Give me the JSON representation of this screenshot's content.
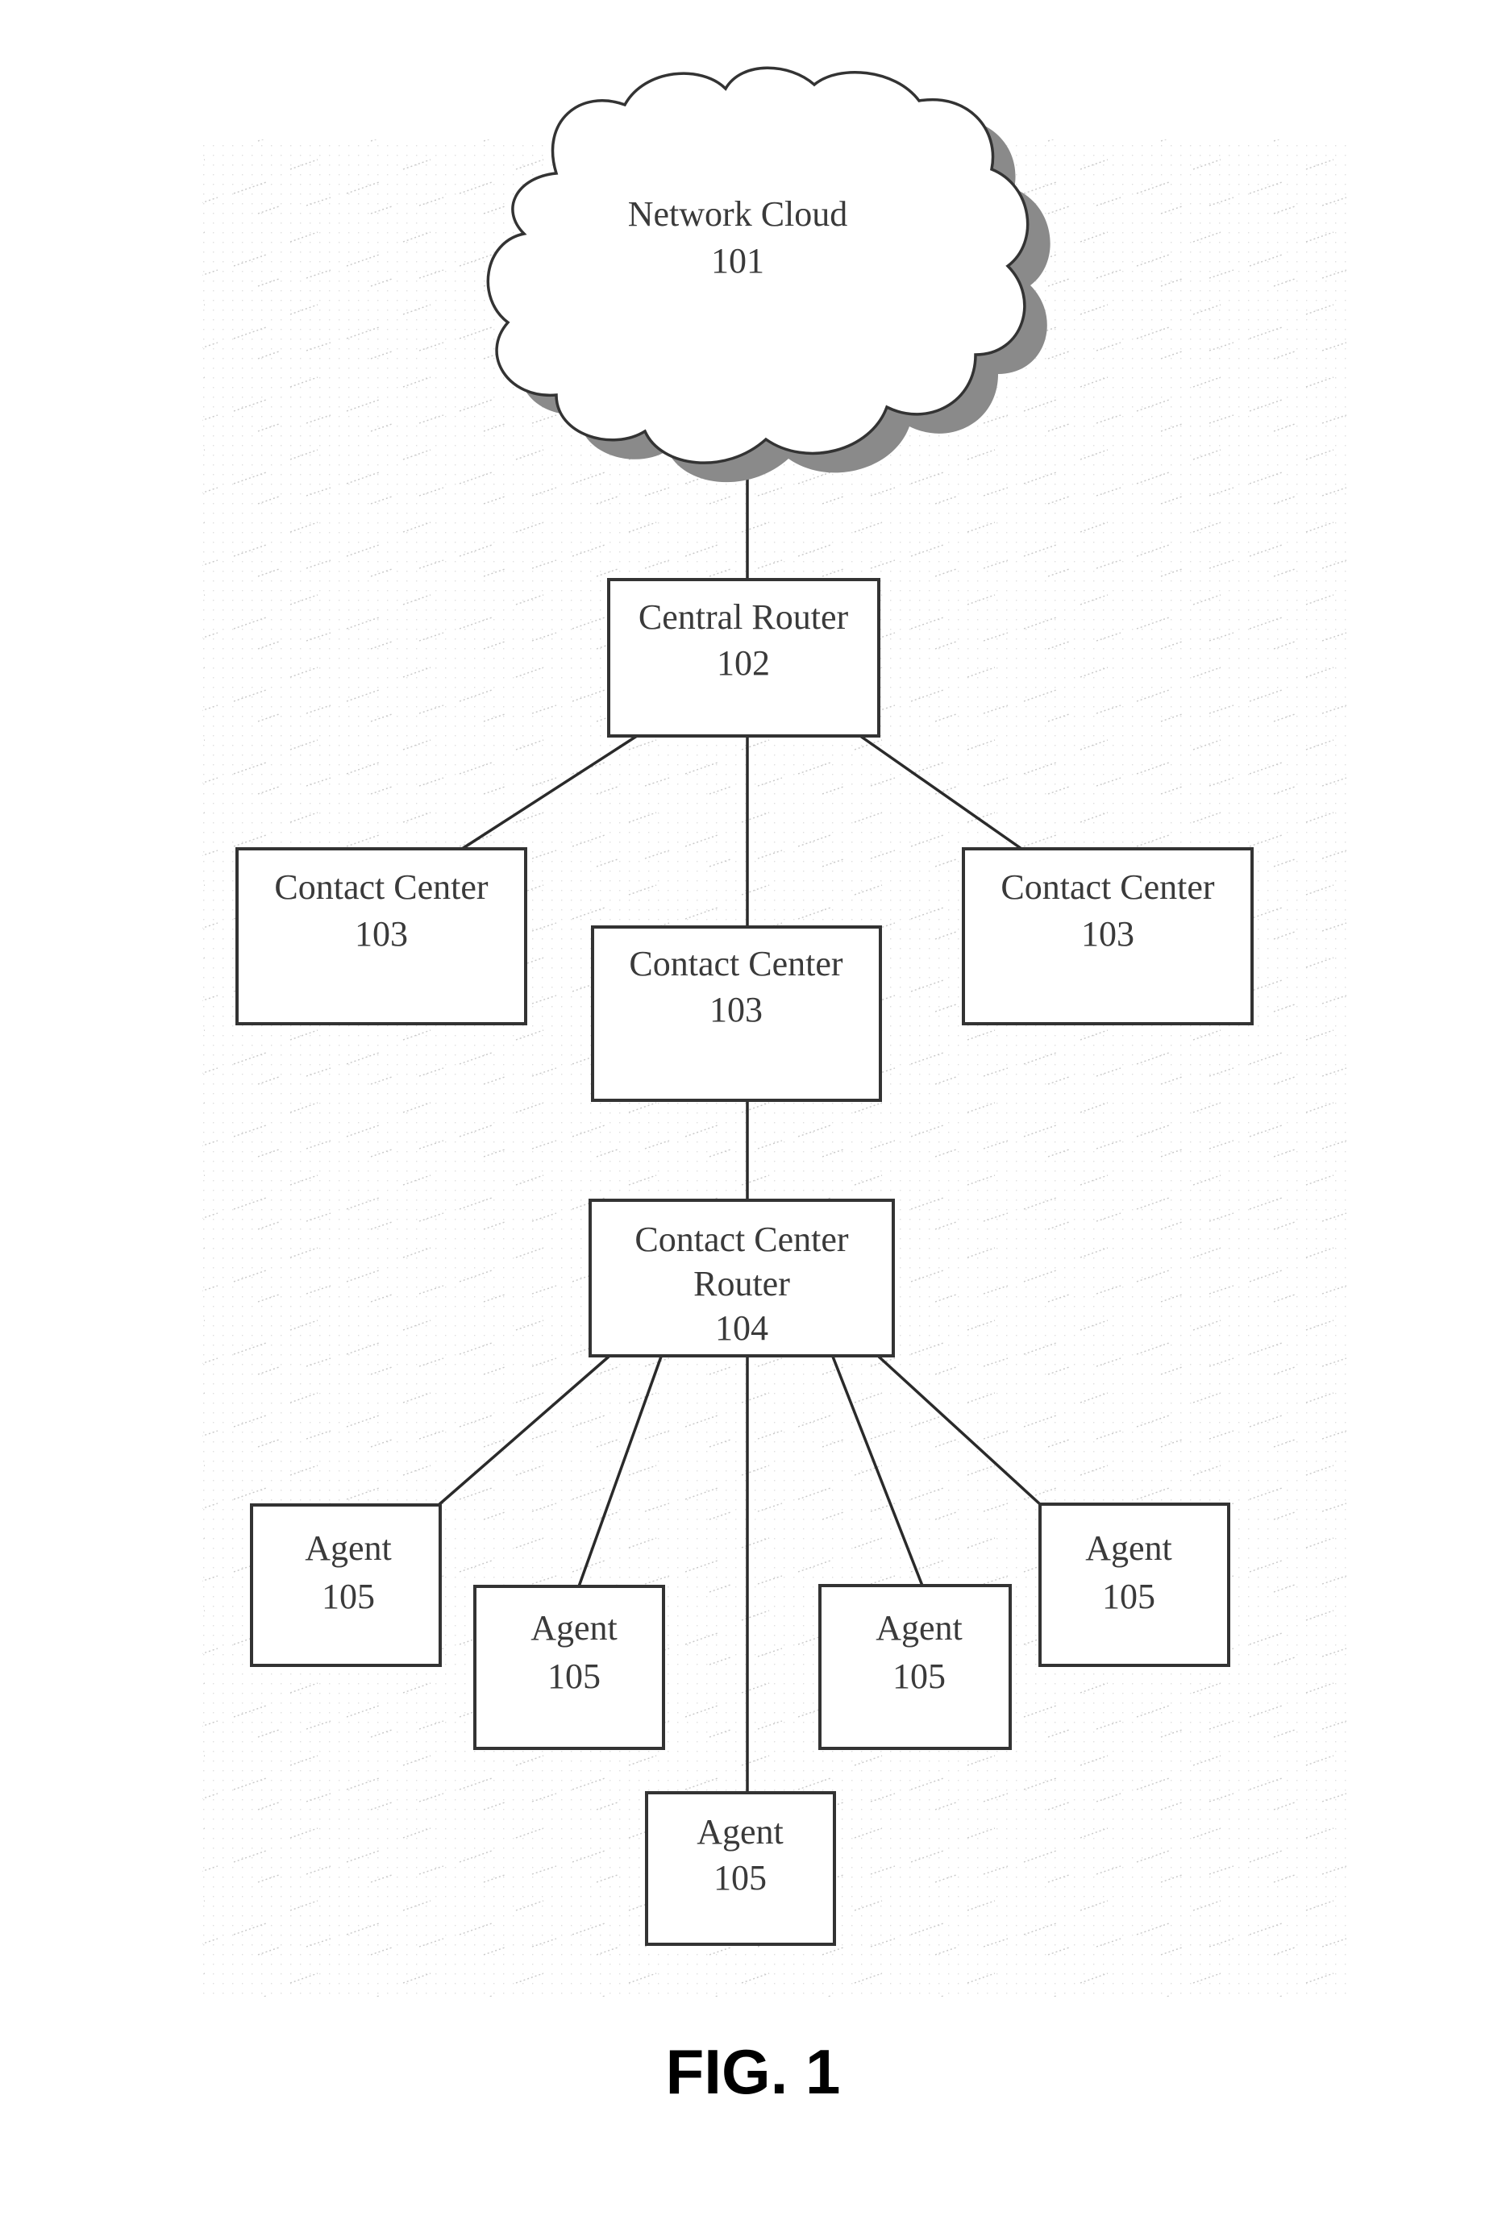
{
  "figure": {
    "label": "FIG. 1"
  },
  "nodes": {
    "network_cloud": {
      "lines": [
        "Network Cloud",
        "101"
      ],
      "shape": "cloud"
    },
    "central_router": {
      "lines": [
        "Central Router",
        "102"
      ]
    },
    "contact_center_left": {
      "lines": [
        "Contact Center",
        "103"
      ]
    },
    "contact_center_middle": {
      "lines": [
        "Contact Center",
        "103"
      ]
    },
    "contact_center_right": {
      "lines": [
        "Contact Center",
        "103"
      ]
    },
    "contact_center_router": {
      "lines": [
        "Contact Center",
        "Router",
        "104"
      ]
    },
    "agent_1": {
      "lines": [
        "Agent",
        "105"
      ]
    },
    "agent_2": {
      "lines": [
        "Agent",
        "105"
      ]
    },
    "agent_3": {
      "lines": [
        "Agent",
        "105"
      ]
    },
    "agent_4": {
      "lines": [
        "Agent",
        "105"
      ]
    },
    "agent_5": {
      "lines": [
        "Agent",
        "105"
      ]
    }
  },
  "edges": [
    [
      "network_cloud",
      "central_router"
    ],
    [
      "central_router",
      "contact_center_left"
    ],
    [
      "central_router",
      "contact_center_middle"
    ],
    [
      "central_router",
      "contact_center_right"
    ],
    [
      "contact_center_middle",
      "contact_center_router"
    ],
    [
      "contact_center_router",
      "agent_1"
    ],
    [
      "contact_center_router",
      "agent_2"
    ],
    [
      "contact_center_router",
      "agent_3"
    ],
    [
      "contact_center_router",
      "agent_4"
    ],
    [
      "contact_center_router",
      "agent_5"
    ]
  ]
}
